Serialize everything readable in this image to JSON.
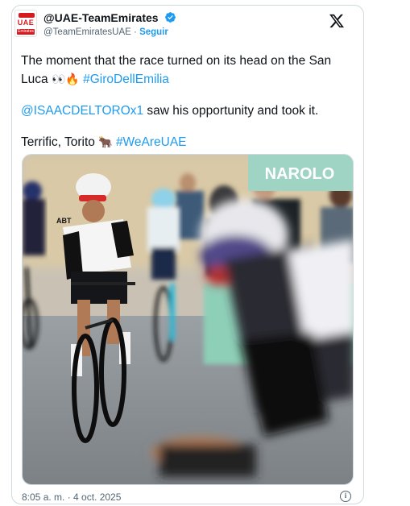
{
  "account": {
    "name": "@UAE-TeamEmirates",
    "handle": "@TeamEmiratesUAE",
    "separator": "·",
    "follow_label": "Seguir",
    "logo_text": "UAE",
    "logo_sub": "Emirates"
  },
  "tweet": {
    "line1": "The moment that the race turned on its head on the San Luca",
    "line1_emojis": "👀🔥",
    "hashtag1": "#GiroDellEmilia",
    "mention": "@ISAACDELTOROx1",
    "line2": " saw his opportunity and took it.",
    "line3": "Terrific, Torito",
    "line3_emoji": "🐂",
    "hashtag2": "#WeAreUAE"
  },
  "photo": {
    "banner_text": "NAROLO",
    "jersey_text": "ABT"
  },
  "footer": {
    "timestamp": "8:05 a. m. · 4 oct. 2025",
    "info_glyph": "i"
  },
  "icons": {
    "verified": "verified-badge-icon",
    "x_logo": "x-logo-icon",
    "info": "info-icon"
  },
  "colors": {
    "link": "#1d9bf0",
    "text": "#0f1419",
    "secondary": "#536471",
    "brand_red": "#d71920"
  }
}
